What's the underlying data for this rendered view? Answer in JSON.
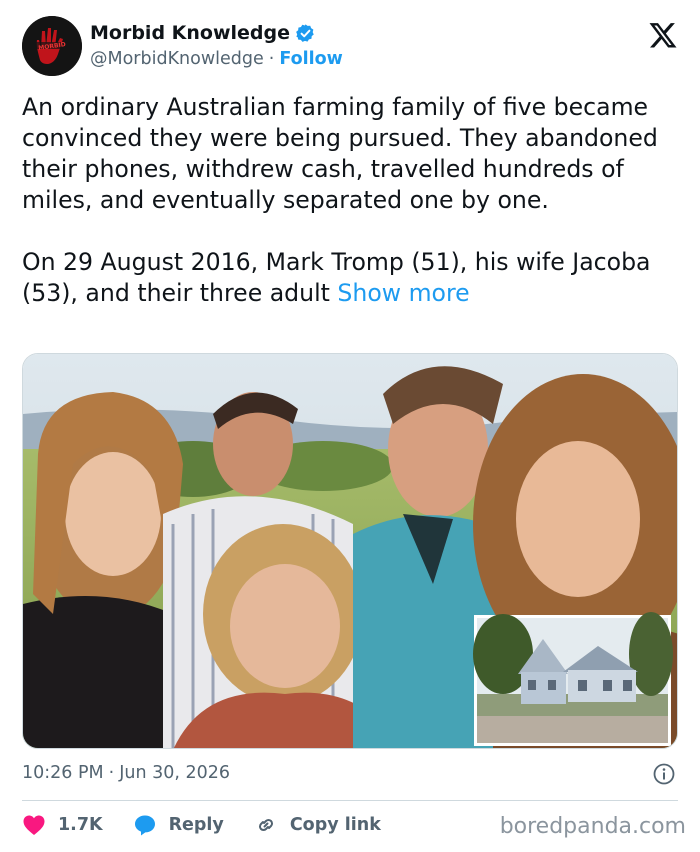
{
  "author": {
    "name": "Morbid Knowledge",
    "handle": "@MorbidKnowledge",
    "separator": "·",
    "follow_label": "Follow",
    "avatar_icon": "red-handprint-avatar",
    "verified_icon": "verified-badge-icon"
  },
  "platform_icon": "x-logo-icon",
  "tweet": {
    "paragraph1": "An ordinary Australian farming family of five became convinced they were being pursued. They abandoned their phones, withdrew cash, travelled hundreds of miles, and eventually separated one by one.",
    "paragraph2": "On 29 August 2016, Mark Tromp (51), his wife Jacoba (53), and their three adult",
    "show_more_label": "Show more"
  },
  "media": {
    "main_image": "family-selfie-photo",
    "inset_image": "farmhouse-photo"
  },
  "meta": {
    "time": "10:26 PM",
    "separator": "·",
    "date": "Jun 30, 2026",
    "info_icon": "info-icon"
  },
  "actions": {
    "like_count": "1.7K",
    "reply_label": "Reply",
    "copy_link_label": "Copy link"
  },
  "watermark": "boredpanda.com",
  "colors": {
    "accent": "#1d9bf0",
    "like": "#f91880",
    "muted": "#536471",
    "text": "#0f1419"
  }
}
